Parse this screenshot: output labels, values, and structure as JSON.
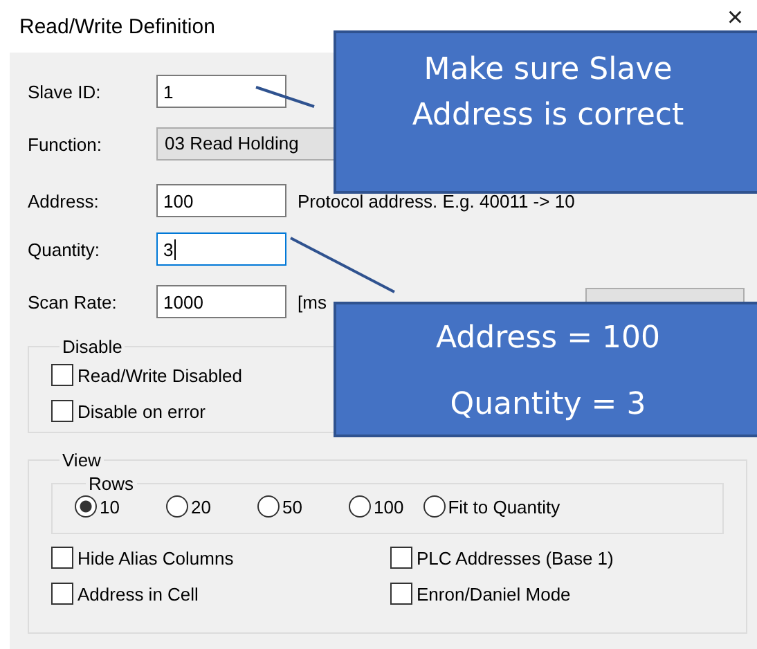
{
  "window": {
    "title": "Read/Write Definition",
    "close": "×"
  },
  "fields": [
    {
      "kind": "input",
      "label": "Slave ID:",
      "value": "1",
      "focused": false
    },
    {
      "kind": "combo",
      "label": "Function:",
      "value": "03 Read Holding"
    },
    {
      "kind": "input",
      "label": "Address:",
      "value": "100",
      "focused": false,
      "hint": "Protocol address. E.g. 40011 -> 10"
    },
    {
      "kind": "input",
      "label": "Quantity:",
      "value": "3",
      "focused": true
    },
    {
      "kind": "input",
      "label": "Scan Rate:",
      "value": "1000",
      "focused": false,
      "hint": "[ms",
      "button": true
    }
  ],
  "disable": {
    "title": "Disable",
    "options": [
      {
        "label": "Read/Write Disabled",
        "checked": false
      },
      {
        "label": "Disable on error",
        "checked": false
      }
    ]
  },
  "view": {
    "title": "View",
    "rows": {
      "title": "Rows",
      "options": [
        {
          "label": "10",
          "selected": true
        },
        {
          "label": "20",
          "selected": false
        },
        {
          "label": "50",
          "selected": false
        },
        {
          "label": "100",
          "selected": false
        },
        {
          "label": "Fit to Quantity",
          "selected": false
        }
      ]
    },
    "options": [
      {
        "label": "Hide Alias Columns",
        "checked": false
      },
      {
        "label": "PLC Addresses (Base 1)",
        "checked": false
      },
      {
        "label": "Address in Cell",
        "checked": false
      },
      {
        "label": "Enron/Daniel Mode",
        "checked": false
      }
    ]
  },
  "callouts": [
    {
      "lines": [
        "Make sure Slave",
        "Address is correct"
      ]
    },
    {
      "lines": [
        "Address = 100",
        "Quantity = 3"
      ]
    }
  ]
}
